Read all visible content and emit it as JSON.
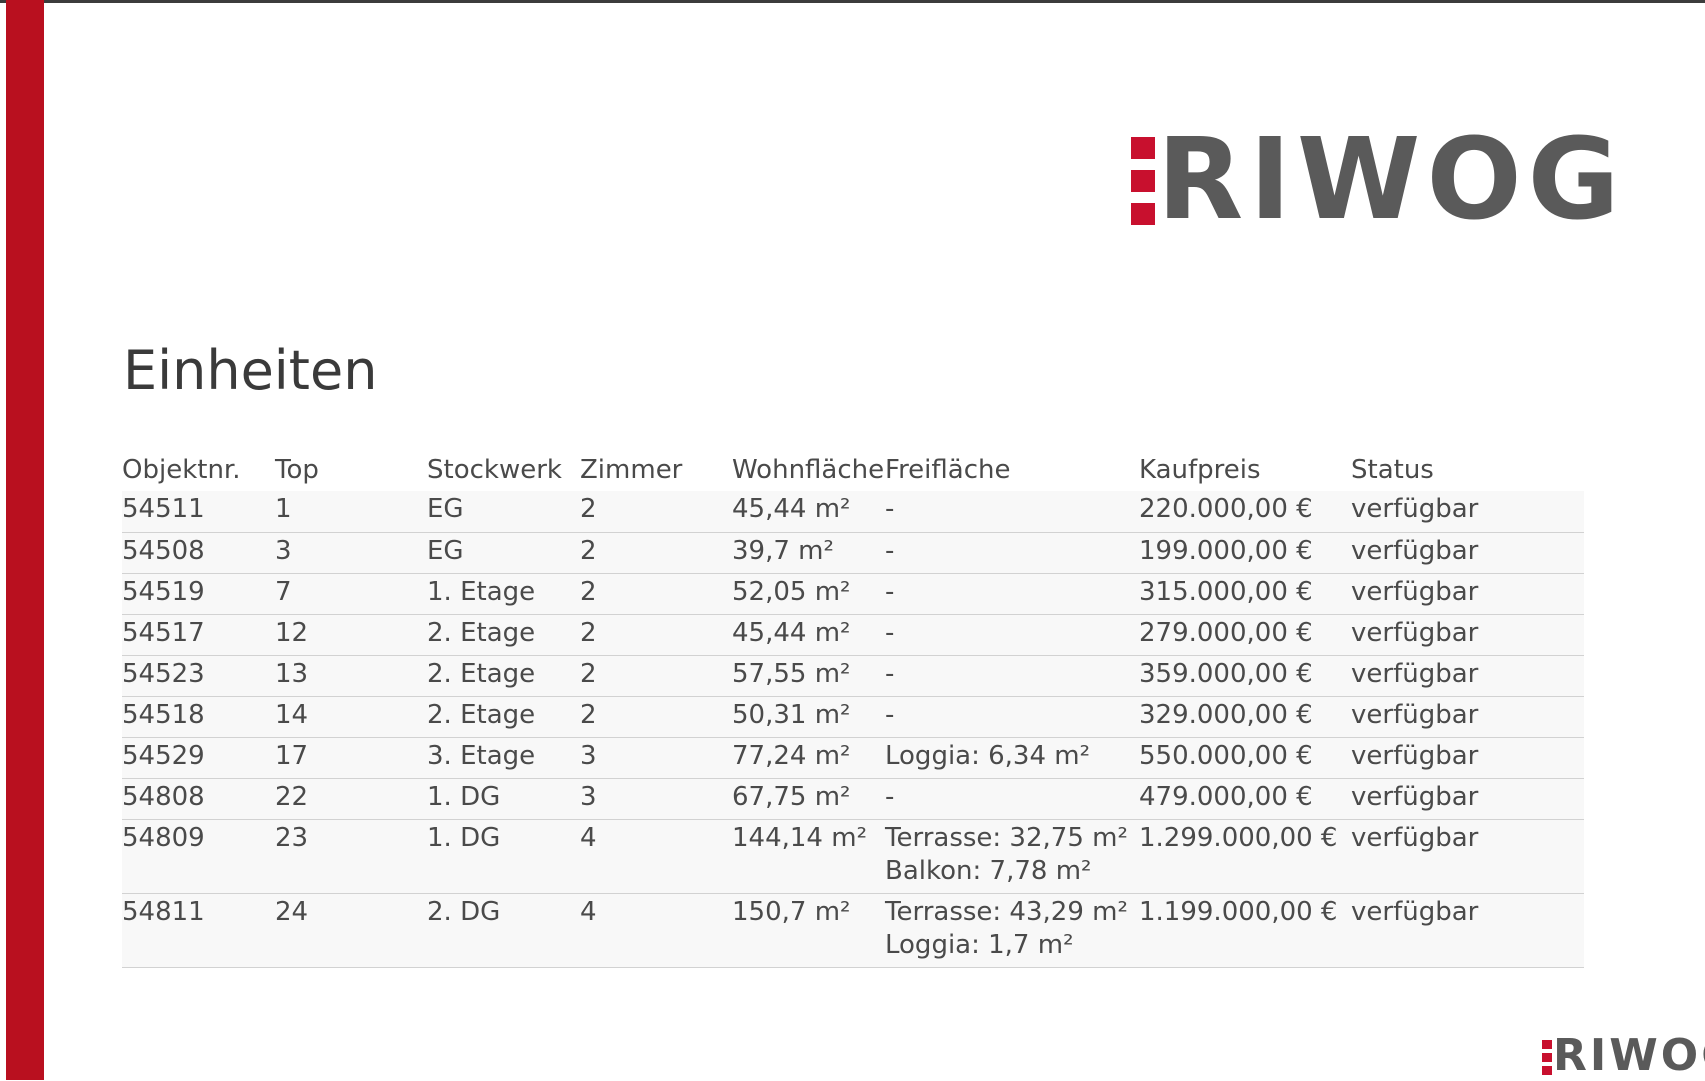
{
  "brand": {
    "logo_text": "RIWOG",
    "color_red": "#c8102e",
    "color_gray": "#5a5a5a",
    "side_bar_color": "#b9101f"
  },
  "page": {
    "title": "Einheiten"
  },
  "table": {
    "headers": [
      "Objektnr.",
      "Top",
      "Stockwerk",
      "Zimmer",
      "Wohnfläche",
      "Freifläche",
      "Kaufpreis",
      "Status"
    ],
    "rows": [
      {
        "objektnr": "54511",
        "top": "1",
        "stockwerk": "EG",
        "zimmer": "2",
        "wohnflaeche": "45,44 m²",
        "freiflaeche": [
          "-"
        ],
        "kaufpreis": "220.000,00 €",
        "status": "verfügbar"
      },
      {
        "objektnr": "54508",
        "top": "3",
        "stockwerk": "EG",
        "zimmer": "2",
        "wohnflaeche": "39,7 m²",
        "freiflaeche": [
          "-"
        ],
        "kaufpreis": "199.000,00 €",
        "status": "verfügbar"
      },
      {
        "objektnr": "54519",
        "top": "7",
        "stockwerk": "1. Etage",
        "zimmer": "2",
        "wohnflaeche": "52,05 m²",
        "freiflaeche": [
          "-"
        ],
        "kaufpreis": "315.000,00 €",
        "status": "verfügbar"
      },
      {
        "objektnr": "54517",
        "top": "12",
        "stockwerk": "2. Etage",
        "zimmer": "2",
        "wohnflaeche": "45,44 m²",
        "freiflaeche": [
          "-"
        ],
        "kaufpreis": "279.000,00 €",
        "status": "verfügbar"
      },
      {
        "objektnr": "54523",
        "top": "13",
        "stockwerk": "2. Etage",
        "zimmer": "2",
        "wohnflaeche": "57,55 m²",
        "freiflaeche": [
          "-"
        ],
        "kaufpreis": "359.000,00 €",
        "status": "verfügbar"
      },
      {
        "objektnr": "54518",
        "top": "14",
        "stockwerk": "2. Etage",
        "zimmer": "2",
        "wohnflaeche": "50,31 m²",
        "freiflaeche": [
          "-"
        ],
        "kaufpreis": "329.000,00 €",
        "status": "verfügbar"
      },
      {
        "objektnr": "54529",
        "top": "17",
        "stockwerk": "3. Etage",
        "zimmer": "3",
        "wohnflaeche": "77,24 m²",
        "freiflaeche": [
          "Loggia: 6,34 m²"
        ],
        "kaufpreis": "550.000,00 €",
        "status": "verfügbar"
      },
      {
        "objektnr": "54808",
        "top": "22",
        "stockwerk": "1. DG",
        "zimmer": "3",
        "wohnflaeche": "67,75 m²",
        "freiflaeche": [
          "-"
        ],
        "kaufpreis": "479.000,00 €",
        "status": "verfügbar"
      },
      {
        "objektnr": "54809",
        "top": "23",
        "stockwerk": "1. DG",
        "zimmer": "4",
        "wohnflaeche": "144,14 m²",
        "freiflaeche": [
          "Terrasse: 32,75 m²",
          "Balkon: 7,78 m²"
        ],
        "kaufpreis": "1.299.000,00 €",
        "status": "verfügbar"
      },
      {
        "objektnr": "54811",
        "top": "24",
        "stockwerk": "2. DG",
        "zimmer": "4",
        "wohnflaeche": "150,7 m²",
        "freiflaeche": [
          "Terrasse: 43,29 m²",
          "Loggia: 1,7 m²"
        ],
        "kaufpreis": "1.199.000,00 €",
        "status": "verfügbar"
      }
    ]
  }
}
